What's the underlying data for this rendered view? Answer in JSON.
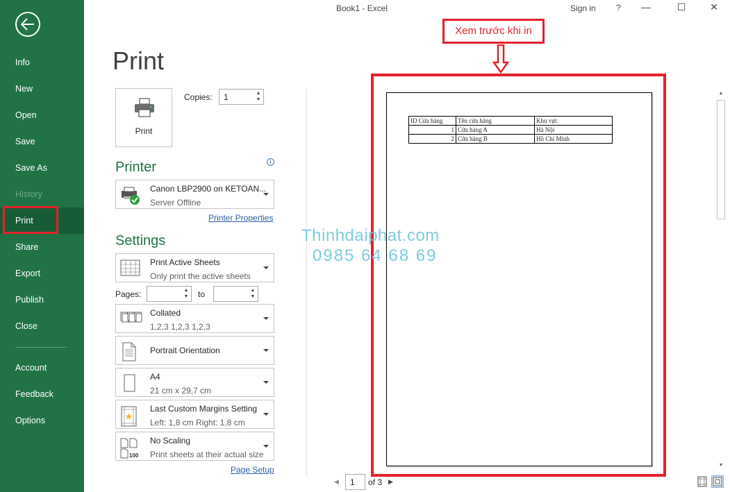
{
  "titlebar": {
    "title": "Book1  -  Excel",
    "sign_in": "Sign in",
    "help": "?",
    "minimize": "—",
    "maximize": "☐",
    "close": "✕"
  },
  "sidebar": {
    "items": [
      {
        "label": "Info"
      },
      {
        "label": "New"
      },
      {
        "label": "Open"
      },
      {
        "label": "Save"
      },
      {
        "label": "Save As"
      },
      {
        "label": "History"
      },
      {
        "label": "Print"
      },
      {
        "label": "Share"
      },
      {
        "label": "Export"
      },
      {
        "label": "Publish"
      },
      {
        "label": "Close"
      },
      {
        "label": "Account"
      },
      {
        "label": "Feedback"
      },
      {
        "label": "Options"
      }
    ]
  },
  "print": {
    "heading": "Print",
    "button_label": "Print",
    "copies_label": "Copies:",
    "copies_value": "1"
  },
  "printer": {
    "section_title": "Printer",
    "name": "Canon LBP2900 on KETOAN...",
    "status": "Server Offline",
    "properties_link": "Printer Properties"
  },
  "settings": {
    "section_title": "Settings",
    "what": {
      "line1": "Print Active Sheets",
      "line2": "Only print the active sheets"
    },
    "pages_label": "Pages:",
    "pages_from": "",
    "to_label": "to",
    "pages_to": "",
    "collate": {
      "line1": "Collated",
      "line2": "1,2,3    1,2,3    1,2,3"
    },
    "orientation": {
      "line1": "Portrait Orientation"
    },
    "paper": {
      "line1": "A4",
      "line2": "21 cm x 29,7 cm"
    },
    "margins": {
      "line1": "Last Custom Margins Setting",
      "line2": "Left:  1,8 cm    Right:  1,8 cm"
    },
    "scaling": {
      "line1": "No Scaling",
      "line2": "Print sheets at their actual size",
      "icon_text": "100"
    },
    "page_setup_link": "Page Setup"
  },
  "preview": {
    "callout": "Xem trước khi in",
    "table": {
      "headers": [
        "ID Cửa hàng",
        "Tên cửa hàng",
        "Khu vực"
      ],
      "rows": [
        [
          "1",
          "Cửa hàng A",
          "Hà Nội"
        ],
        [
          "2",
          "Cửa hàng B",
          "Hồ Chí Minh"
        ]
      ]
    },
    "watermark_line1": "Thinhdaiphat.com",
    "watermark_line2": "0985 64 68 69",
    "page_current": "1",
    "page_of": "of 3"
  },
  "colors": {
    "sidebar_bg": "#217346",
    "accent_green": "#217346",
    "highlight_red": "#e5202b",
    "link_blue": "#2a5ea7"
  }
}
